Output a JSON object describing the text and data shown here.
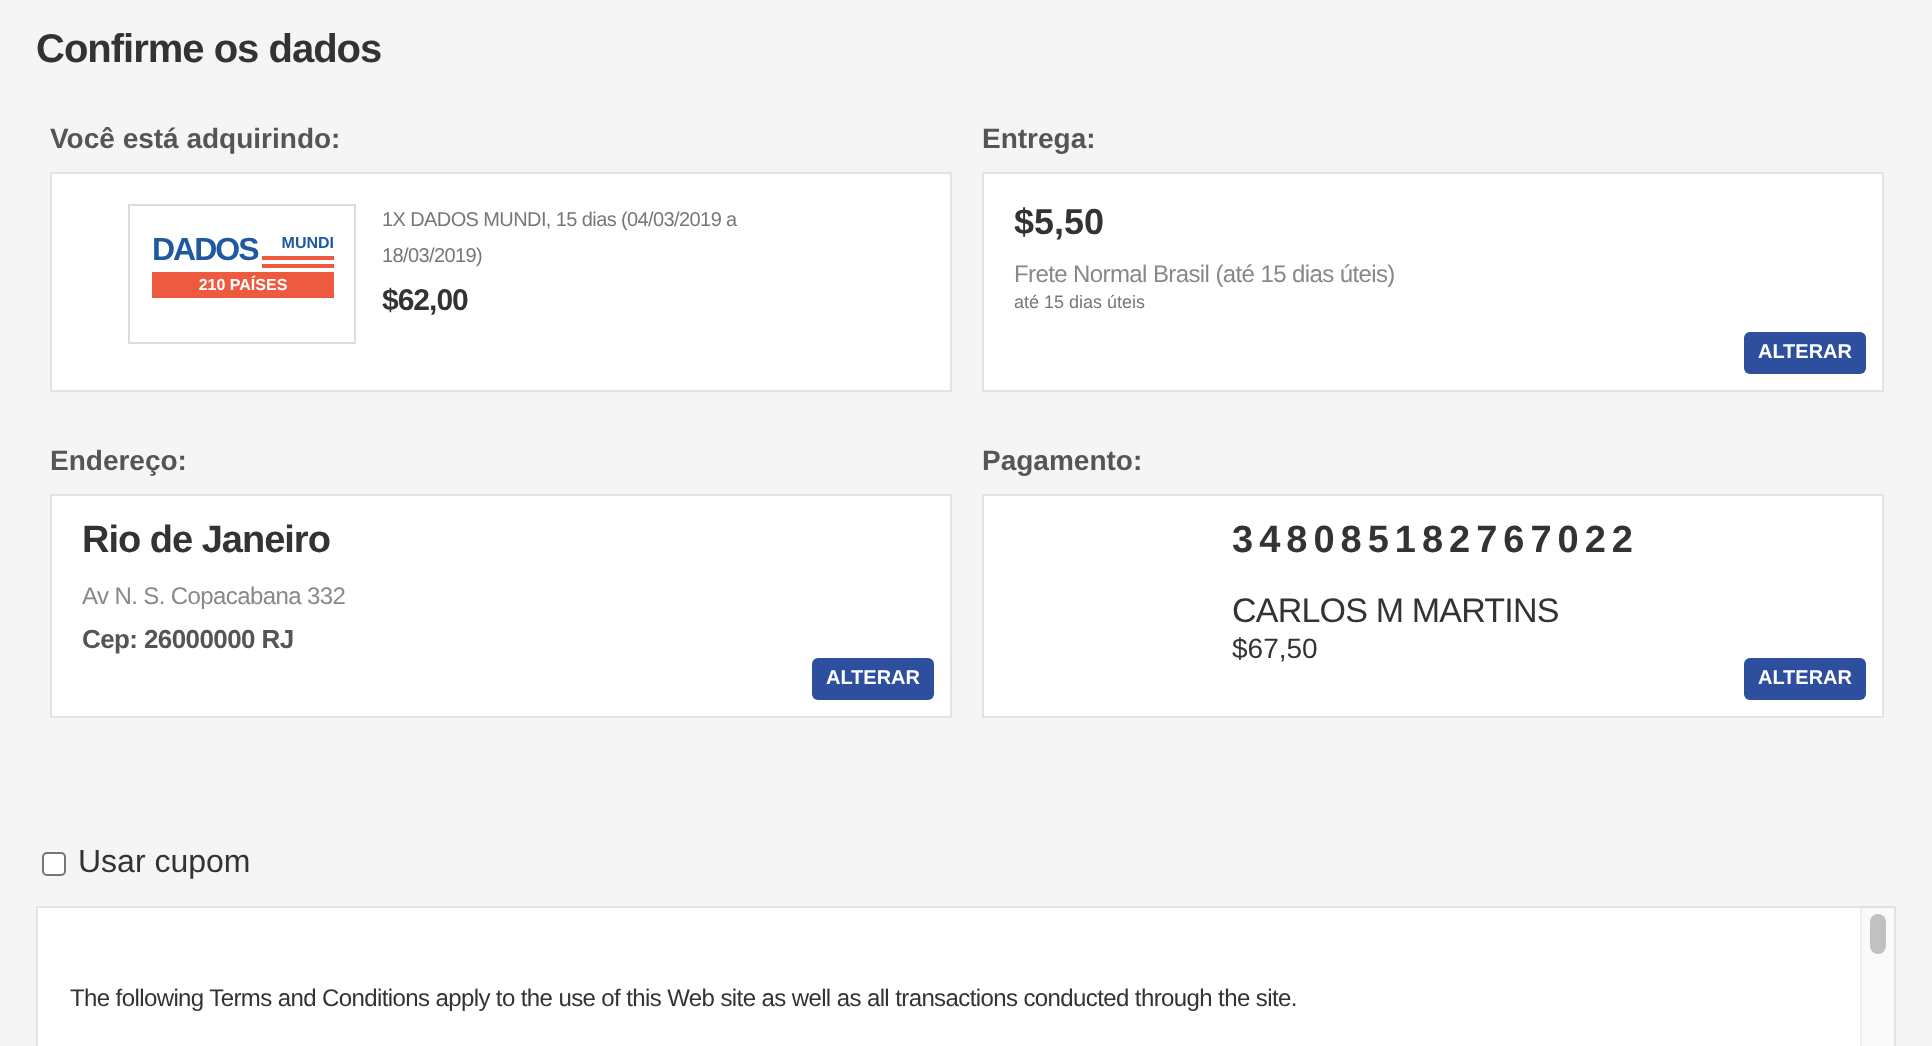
{
  "title": "Confirme os dados",
  "product": {
    "label": "Você está adquirindo:",
    "logo": {
      "word": "DADOS",
      "accent": "MUNDI",
      "banner": "210 PAÍSES"
    },
    "description": "1X DADOS MUNDI, 15 dias (04/03/2019 a 18/03/2019)",
    "price": "$62,00"
  },
  "delivery": {
    "label": "Entrega:",
    "price": "$5,50",
    "method": "Frete Normal Brasil (até 15 dias úteis)",
    "note": "até 15 dias úteis",
    "button": "ALTERAR"
  },
  "address": {
    "label": "Endereço:",
    "city": "Rio de Janeiro",
    "street": "Av N. S. Copacabana 332",
    "zip": "Cep: 26000000 RJ",
    "button": "ALTERAR"
  },
  "payment": {
    "label": "Pagamento:",
    "card_number": "348085182767022",
    "holder": "CARLOS M MARTINS",
    "total": "$67,50",
    "button": "ALTERAR"
  },
  "coupon": {
    "label": "Usar cupom",
    "checked": false
  },
  "terms": {
    "text": "The following Terms and Conditions apply to the use of this Web site as well as all transactions conducted through the site."
  }
}
